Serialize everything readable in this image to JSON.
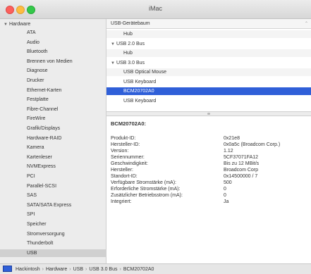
{
  "window": {
    "title": "iMac"
  },
  "sidebar": {
    "header": "Hardware",
    "items": [
      "ATA",
      "Audio",
      "Bluetooth",
      "Brennen von Medien",
      "Diagnose",
      "Drucker",
      "Ethernet-Karten",
      "Festplatte",
      "Fibre-Channel",
      "FireWire",
      "Grafik/Displays",
      "Hardware-RAID",
      "Kamera",
      "Kartenleser",
      "NVMExpress",
      "PCI",
      "Parallel-SCSI",
      "SAS",
      "SATA/SATA Express",
      "SPI",
      "Speicher",
      "Stromversorgung",
      "Thunderbolt",
      "USB"
    ],
    "selected": "USB"
  },
  "tree": {
    "column_header": "USB-Gerätebaum",
    "rows": [
      {
        "label": "Hub",
        "indent": 2,
        "expanded": false
      },
      {
        "label": "USB 2.0 Bus",
        "indent": 1,
        "expanded": true
      },
      {
        "label": "Hub",
        "indent": 2,
        "expanded": false
      },
      {
        "label": "USB 3.0 Bus",
        "indent": 1,
        "expanded": true
      },
      {
        "label": "USB Optical Mouse",
        "indent": 2,
        "expanded": false
      },
      {
        "label": "USB Keyboard",
        "indent": 2,
        "expanded": false
      },
      {
        "label": "BCM20702A0",
        "indent": 2,
        "expanded": false,
        "selected": true
      },
      {
        "label": "USB Keyboard",
        "indent": 2,
        "expanded": false
      }
    ]
  },
  "detail": {
    "title": "BCM20702A0:",
    "rows": [
      {
        "key": "Produkt-ID:",
        "value": "0x21e8"
      },
      {
        "key": "Hersteller-ID:",
        "value": "0x0a5c  (Broadcom Corp.)"
      },
      {
        "key": "Version:",
        "value": "1.12"
      },
      {
        "key": "Seriennummer:",
        "value": "5CF37071FA12"
      },
      {
        "key": "Geschwindigkeit:",
        "value": "Bis zu 12 MBit/s"
      },
      {
        "key": "Hersteller:",
        "value": "Broadcom Corp"
      },
      {
        "key": "Standort-ID:",
        "value": "0x14500000 / 7"
      },
      {
        "key": "Verfügbare Stromstärke (mA):",
        "value": "500"
      },
      {
        "key": "Erforderliche Stromstärke (mA):",
        "value": "0"
      },
      {
        "key": "Zusätzlicher Betriebsstrom (mA):",
        "value": "0"
      },
      {
        "key": "Integriert:",
        "value": "Ja"
      }
    ]
  },
  "pathbar": {
    "crumbs": [
      "Hackintosh",
      "Hardware",
      "USB",
      "USB 3.0 Bus",
      "BCM20702A0"
    ],
    "separator": "›"
  },
  "colors": {
    "selection": "#2f5fd8",
    "sidebar_bg": "#ececec"
  }
}
